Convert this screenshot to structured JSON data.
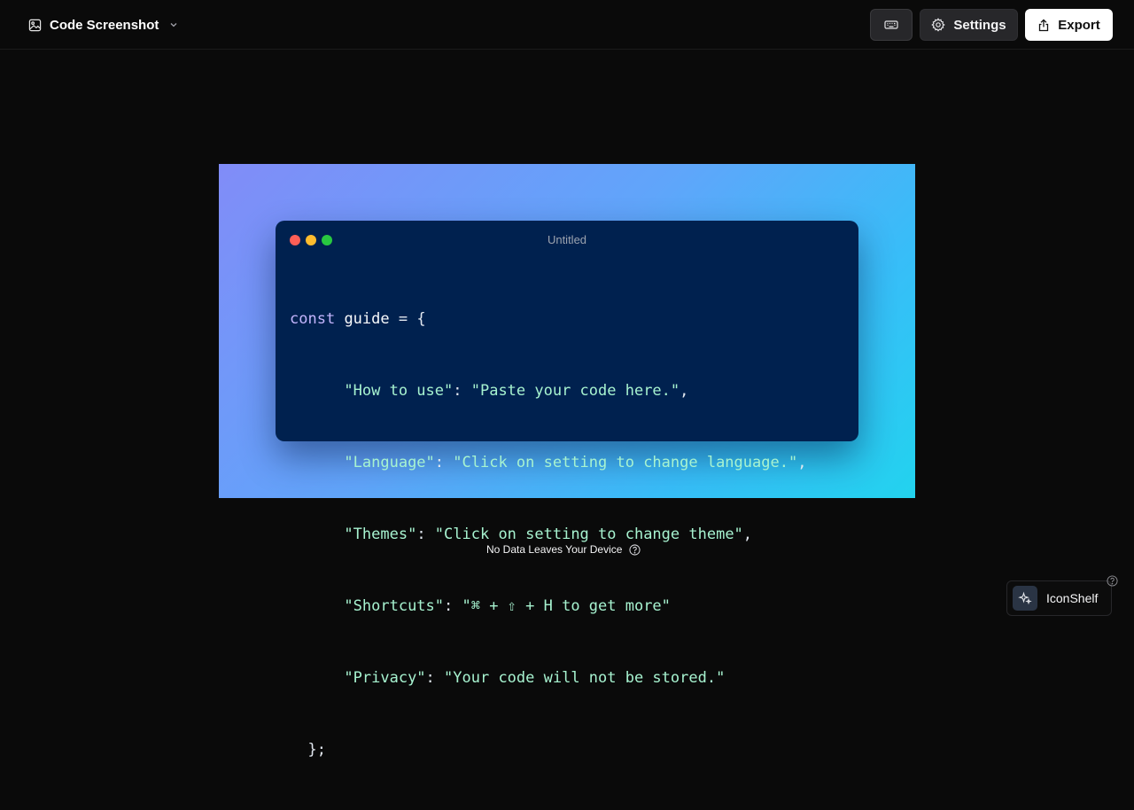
{
  "header": {
    "title": "Code Screenshot",
    "settings_label": "Settings",
    "export_label": "Export"
  },
  "icons": {
    "logo": "image-icon",
    "dropdown": "chevron-down-icon",
    "keyboard": "keyboard-icon",
    "settings": "gear-icon",
    "export": "share-upload-icon",
    "info": "question-circle-icon",
    "iconshelf": "sparkles-icon"
  },
  "editor": {
    "window_title": "Untitled",
    "code": {
      "l1": {
        "kw": "const",
        "name": "guide",
        "rest": " = {"
      },
      "entries": [
        {
          "key": "\"How to use\"",
          "value": "\"Paste your code here.\"",
          "end": ","
        },
        {
          "key": "\"Language\"",
          "value": "\"Click on setting to change language.\"",
          "end": ","
        },
        {
          "key": "\"Themes\"",
          "value": "\"Click on setting to change theme\"",
          "end": ","
        },
        {
          "key": "\"Shortcuts\"",
          "value": "\"⌘ + ⇧ + H to get more\"",
          "end": ""
        },
        {
          "key": "\"Privacy\"",
          "value": "\"Your code will not be stored.\"",
          "end": ""
        }
      ],
      "close": "  };"
    }
  },
  "footer": {
    "note": "No Data Leaves Your Device"
  },
  "widget": {
    "label": "IconShelf"
  },
  "colors": {
    "background": "#0a0a0a",
    "window": "#00214f",
    "gradient_start": "#818cf8",
    "gradient_end": "#22d3ee",
    "string": "#a7f3d0",
    "keyword": "#c4b5fd"
  }
}
